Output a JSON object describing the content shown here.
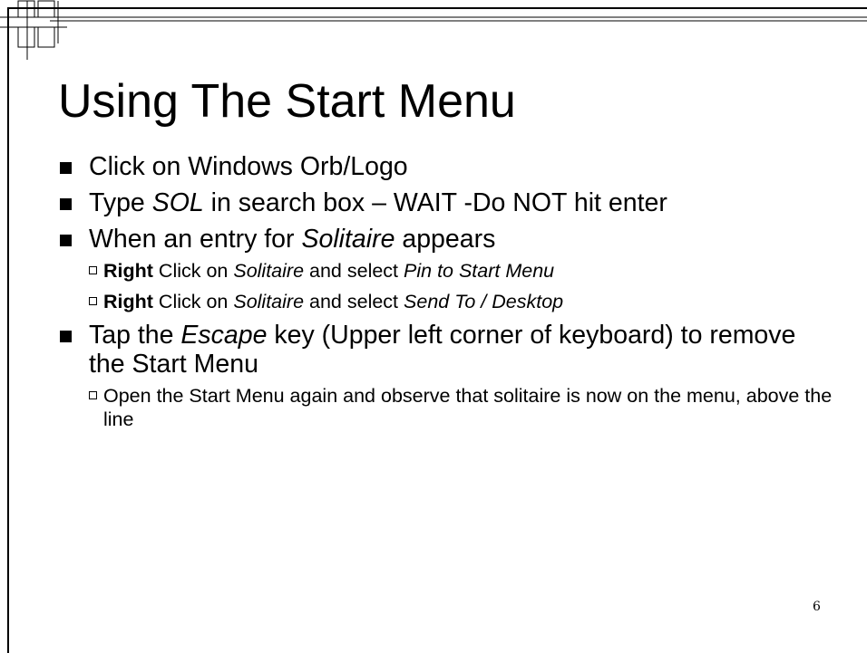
{
  "slide": {
    "title": "Using The Start Menu",
    "page_number": "6",
    "bullets": [
      {
        "text": "Click on Windows Orb/Logo"
      },
      {
        "pre": "Type ",
        "em": "SOL",
        "post": "  in search box – WAIT -Do NOT hit enter"
      },
      {
        "pre": "When an entry for ",
        "em": "Solitaire",
        "post": " appears",
        "sub": [
          {
            "bold": "Right",
            "t1": " Click on ",
            "em1": "Solitaire",
            "t2": "  and select ",
            "em2": "Pin to Start Menu"
          },
          {
            "bold": "Right",
            "t1": " Click on ",
            "em1": "Solitaire",
            "t2": "  and select ",
            "em2": "Send To / Desktop"
          }
        ]
      },
      {
        "pre": "Tap the ",
        "em": "Escape",
        "post": " key (Upper left corner of keyboard) to remove the Start Menu",
        "sub": [
          {
            "text": "Open the Start Menu again and observe that solitaire is now on the menu, above the line"
          }
        ]
      }
    ]
  }
}
